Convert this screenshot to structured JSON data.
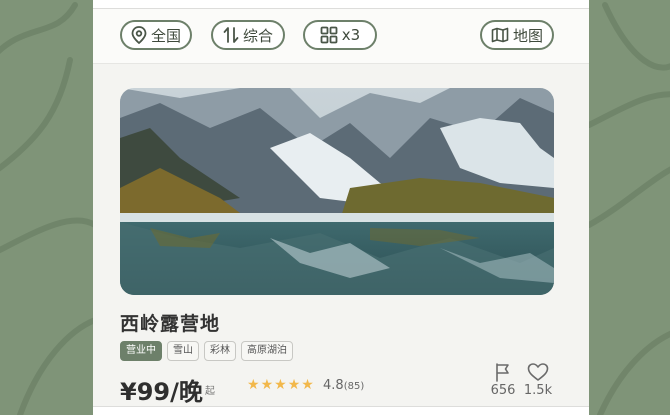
{
  "theme": {
    "accent": "#6d806a",
    "background": "#7f9478",
    "star_color": "#f2b84b"
  },
  "toolbar": {
    "region_icon": "location-pin-icon",
    "region_label": "全国",
    "sort_icon": "sort-arrows-icon",
    "sort_label": "综合",
    "layout_icon": "grid-icon",
    "layout_label": "x3",
    "map_icon": "map-icon",
    "map_label": "地图"
  },
  "listing": {
    "name": "西岭露营地",
    "tags": [
      "营业中",
      "雪山",
      "彩林",
      "高原湖泊"
    ],
    "price": "¥99/晚",
    "price_suffix": "起",
    "star_count": 5,
    "rating": "4.8",
    "review_count": "(85)",
    "flag_icon": "flag-icon",
    "flag_count": "656",
    "like_icon": "heart-icon",
    "like_count": "1.5k"
  }
}
